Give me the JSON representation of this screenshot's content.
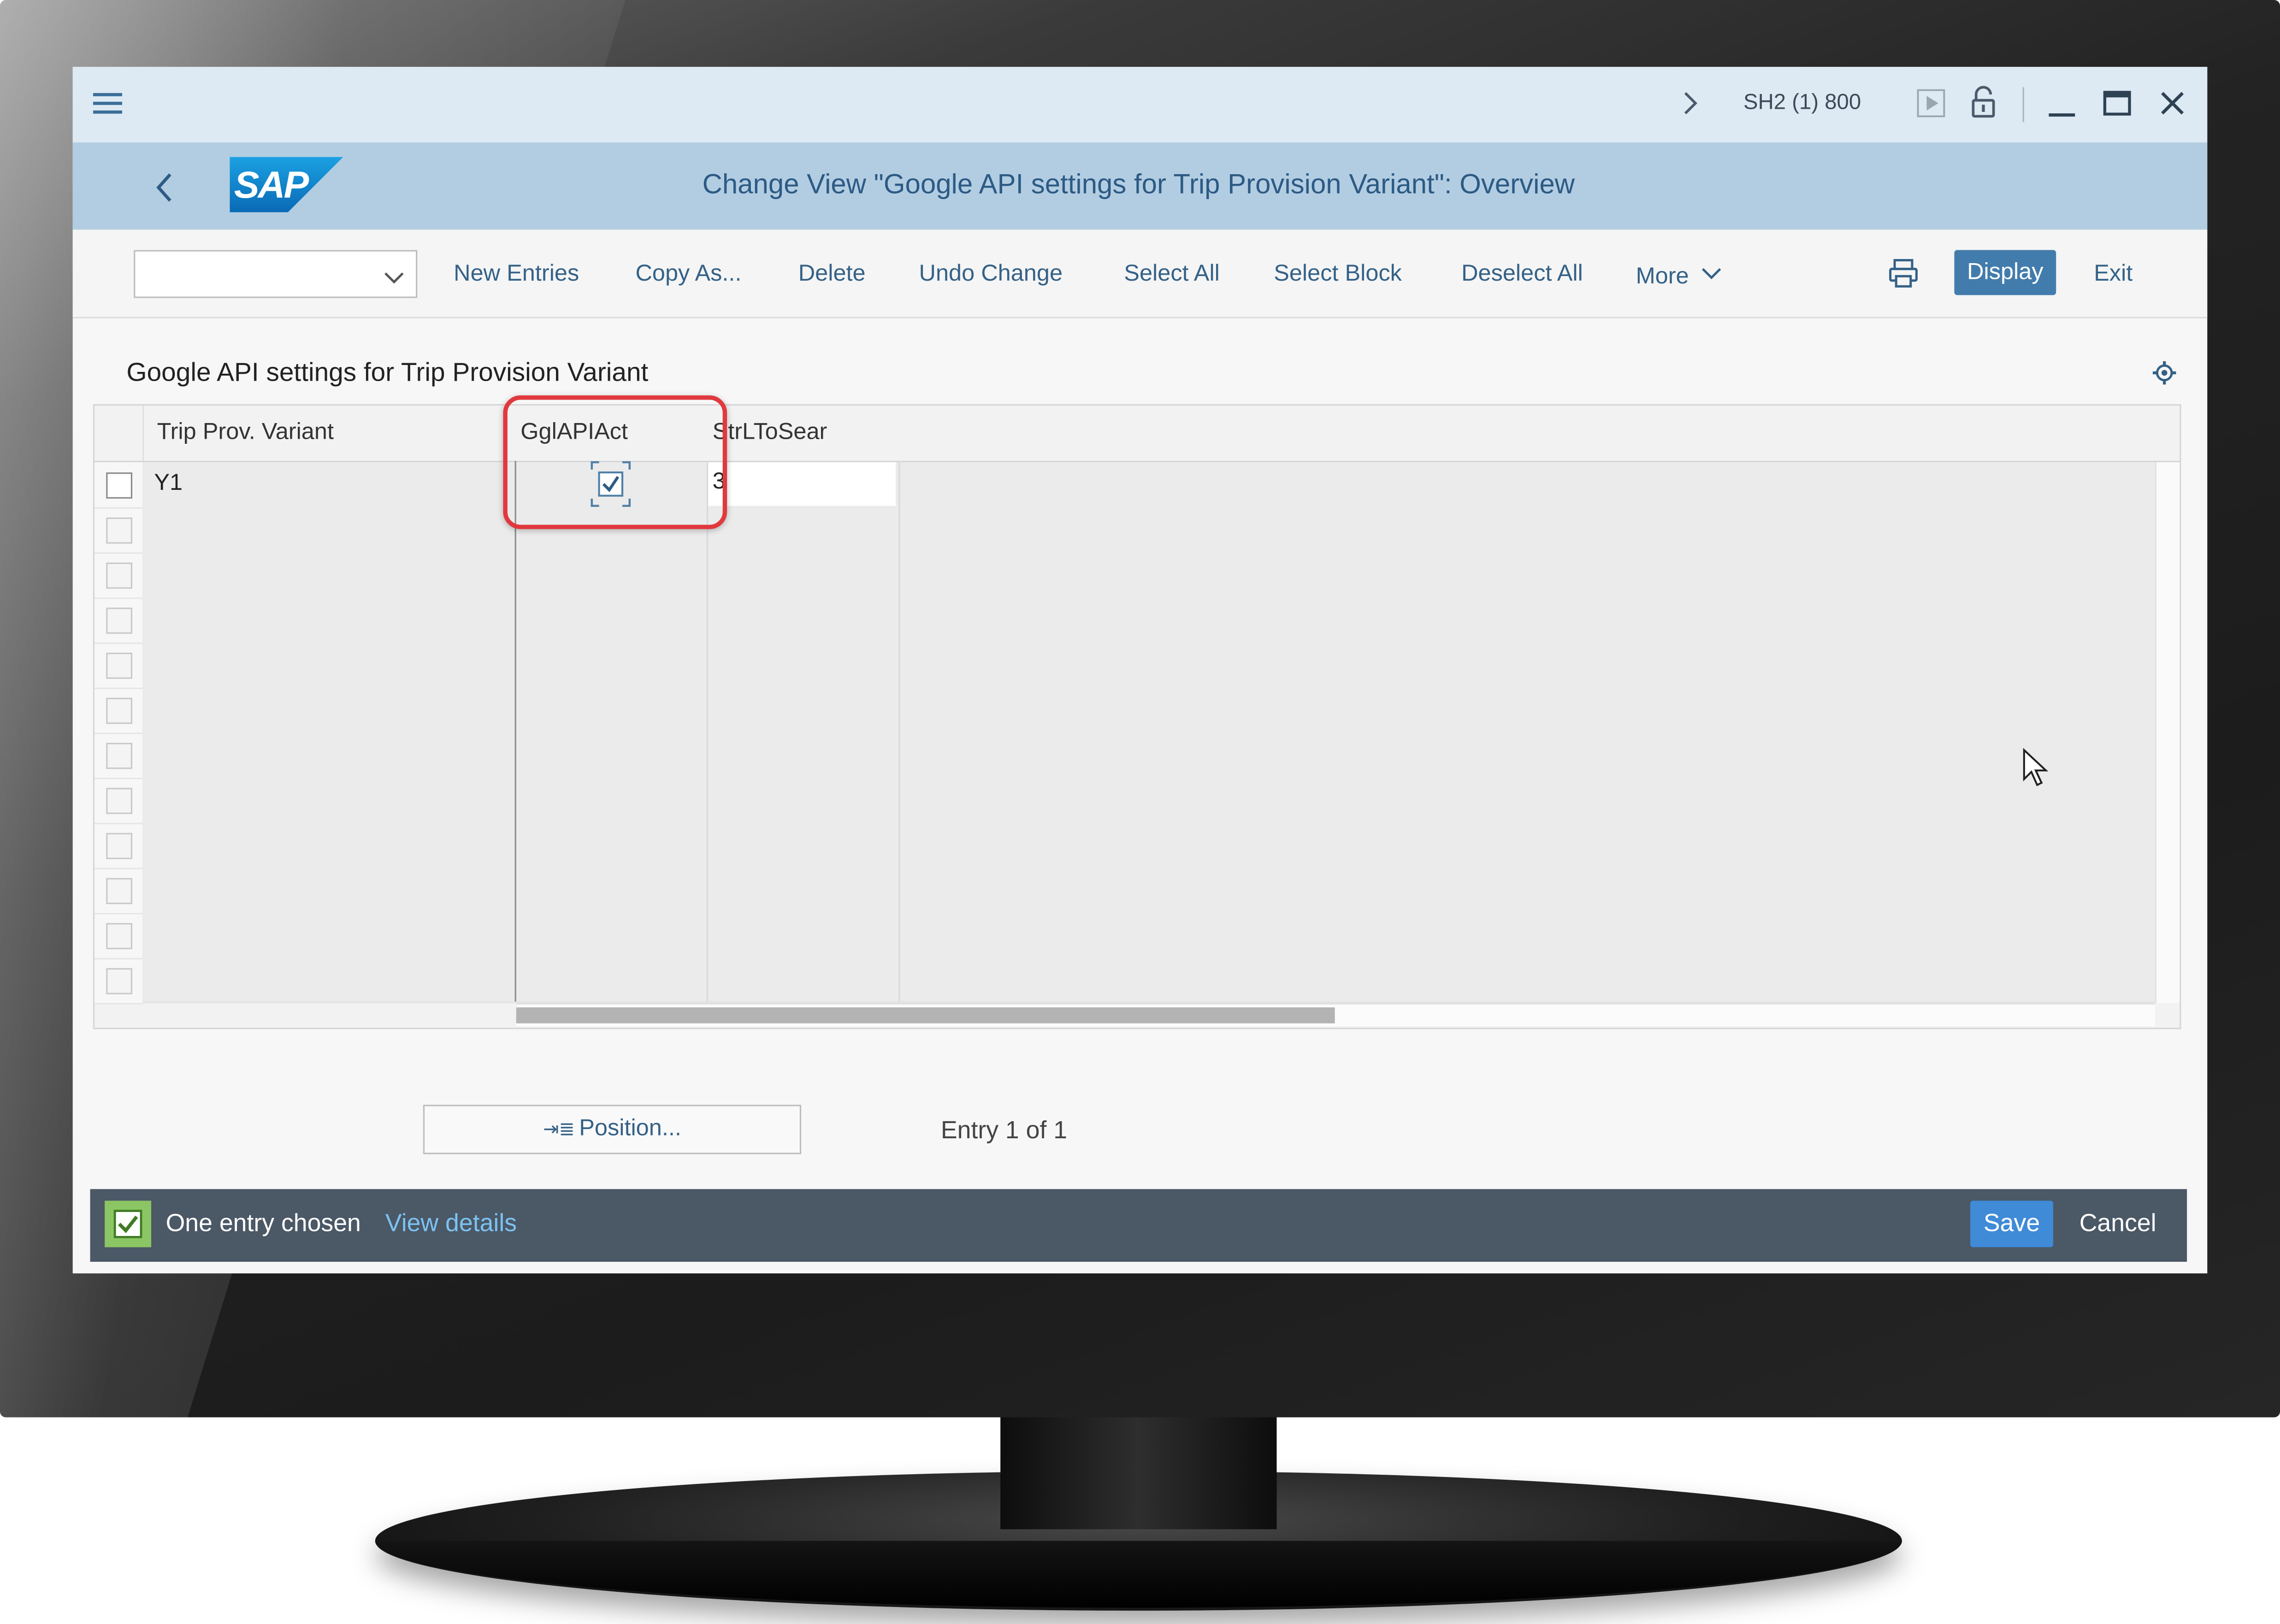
{
  "titlebar": {
    "system": "SH2 (1) 800"
  },
  "header": {
    "logo": "SAP",
    "title": "Change View \"Google API settings for Trip Provision Variant\": Overview"
  },
  "toolbar": {
    "dropdown_value": "",
    "new_entries": "New Entries",
    "copy_as": "Copy As...",
    "delete": "Delete",
    "undo_change": "Undo Change",
    "select_all": "Select All",
    "select_block": "Select Block",
    "deselect_all": "Deselect All",
    "more": "More",
    "display": "Display",
    "exit": "Exit"
  },
  "section": {
    "title": "Google API settings for Trip Provision Variant"
  },
  "table": {
    "columns": [
      "Trip Prov. Variant",
      "GglAPIAct",
      "StrLToSear"
    ],
    "rows": [
      {
        "variant": "Y1",
        "api_active": true,
        "str_l_to_sear": "3"
      }
    ],
    "empty_rows": 11
  },
  "position": {
    "button": "Position...",
    "entry_info": "Entry 1 of 1"
  },
  "footer": {
    "message": "One entry chosen",
    "details_link": "View details",
    "save": "Save",
    "cancel": "Cancel"
  },
  "colors": {
    "header_bg": "#b2cde2",
    "titlebar_bg": "#dde9f3",
    "link": "#346187",
    "primary_button": "#427cac",
    "footer_bg": "#4b5866",
    "highlight": "#e0393e"
  }
}
